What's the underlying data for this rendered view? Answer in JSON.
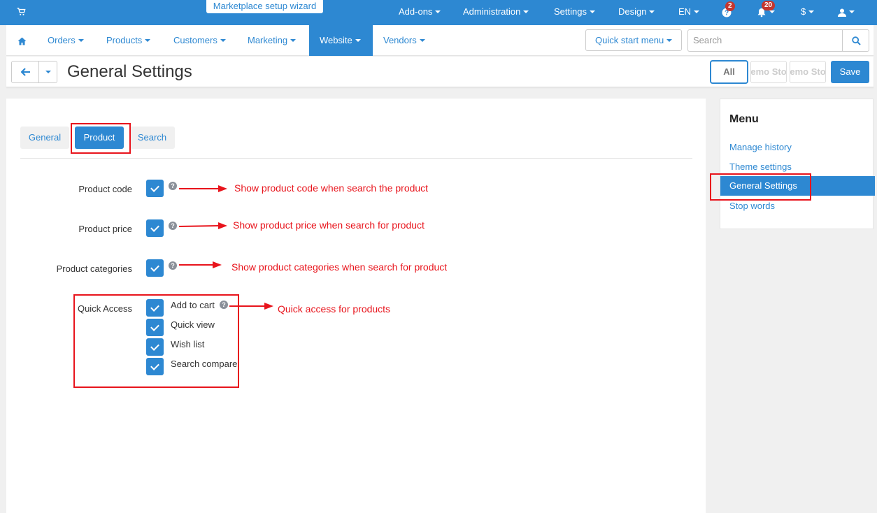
{
  "topbar": {
    "wizard": "Marketplace setup wizard",
    "items": [
      "Add-ons",
      "Administration",
      "Settings",
      "Design",
      "EN"
    ],
    "help_badge": "2",
    "notif_badge": "20",
    "currency": "$"
  },
  "nav": {
    "items": [
      "Orders",
      "Products",
      "Customers",
      "Marketing",
      "Website",
      "Vendors"
    ],
    "active": "Website",
    "quick_start": "Quick start menu",
    "search_placeholder": "Search"
  },
  "titlebar": {
    "title": "General Settings",
    "storefront_all": "All",
    "storefront_1": "Demo Store",
    "storefront_2": "Demo Store",
    "save": "Save"
  },
  "tabs": [
    "General",
    "Product",
    "Search"
  ],
  "active_tab": "Product",
  "settings": {
    "product_code": "Product code",
    "product_price": "Product price",
    "product_categories": "Product categories",
    "quick_access": "Quick Access",
    "quick_options": [
      "Add to cart",
      "Quick view",
      "Wish list",
      "Search compare"
    ]
  },
  "annotations": {
    "code": "Show product code when search the product",
    "price": "Show product price when search for product",
    "categories": "Show product categories when search for product",
    "quick": "Quick access for products"
  },
  "sidebar": {
    "title": "Menu",
    "links": [
      "Manage history",
      "Theme settings",
      "General Settings",
      "Stop words"
    ],
    "active": "General Settings"
  },
  "colors": {
    "primary": "#2d88d2",
    "annotation": "#e8141c"
  }
}
